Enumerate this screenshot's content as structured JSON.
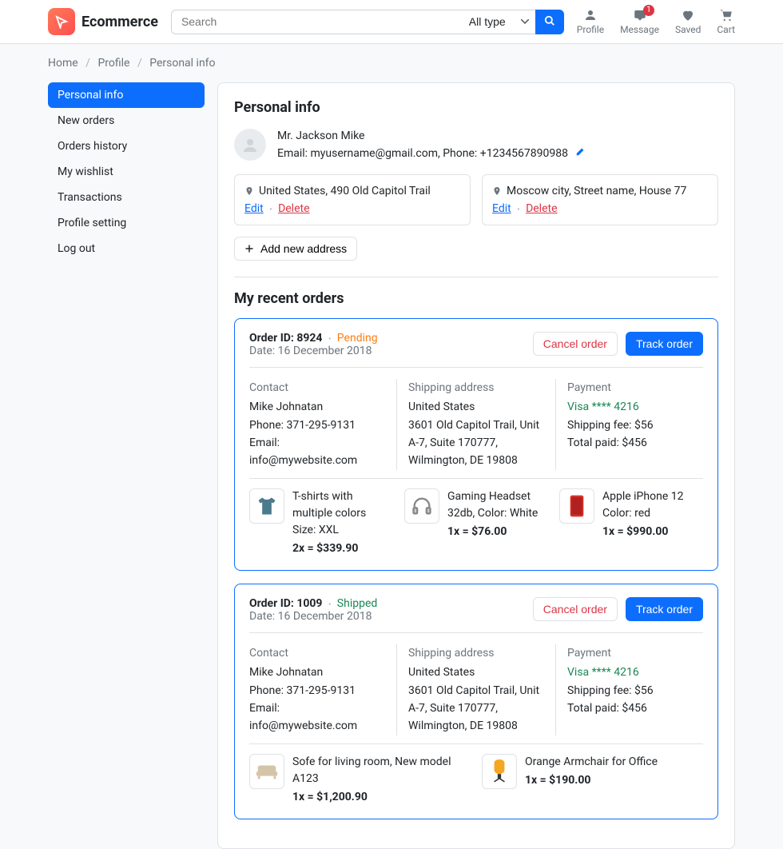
{
  "brand": "Ecommerce",
  "search": {
    "placeholder": "Search",
    "select": "All type"
  },
  "headerNav": {
    "profile": "Profile",
    "message": "Message",
    "messageBadge": "1",
    "saved": "Saved",
    "cart": "Cart"
  },
  "breadcrumb": {
    "home": "Home",
    "profile": "Profile",
    "current": "Personal info"
  },
  "sidebar": [
    "Personal info",
    "New orders",
    "Orders history",
    "My wishlist",
    "Transactions",
    "Profile setting",
    "Log out"
  ],
  "personal": {
    "heading": "Personal info",
    "name": "Mr. Jackson Mike",
    "contact": "Email: myusername@gmail.com, Phone: +1234567890988",
    "addresses": [
      {
        "line": "United States, 490 Old Capitol Trail",
        "edit": "Edit",
        "delete": "Delete"
      },
      {
        "line": "Moscow city, Street name, House 77",
        "edit": "Edit",
        "delete": "Delete"
      }
    ],
    "addBtn": "Add new address"
  },
  "recent": {
    "heading": "My recent orders",
    "orders": [
      {
        "idLabel": "Order ID: 8924",
        "status": "Pending",
        "statusClass": "status-pending",
        "date": "Date: 16 December 2018",
        "cancel": "Cancel order",
        "track": "Track order",
        "contact": {
          "heading": "Contact",
          "name": "Mike Johnatan",
          "phone": "Phone: 371-295-9131",
          "email": "Email: info@mywebsite.com"
        },
        "shipping": {
          "heading": "Shipping address",
          "country": "United States",
          "line": "3601 Old Capitol Trail, Unit A-7, Suite 170777, Wilmington, DE 19808"
        },
        "payment": {
          "heading": "Payment",
          "card": "Visa **** 4216",
          "fee": "Shipping fee: $56",
          "total": "Total paid: $456"
        },
        "items": [
          {
            "name": "T-shirts with multiple colors",
            "variant": "Size: XXL",
            "price": "2x = $339.90",
            "icon": "tshirt"
          },
          {
            "name": "Gaming Headset 32db, Color: White",
            "variant": "",
            "price": "1x = $76.00",
            "icon": "headset"
          },
          {
            "name": "Apple iPhone 12",
            "variant": "Color: red",
            "price": "1x = $990.00",
            "icon": "phone"
          }
        ]
      },
      {
        "idLabel": "Order ID: 1009",
        "status": "Shipped",
        "statusClass": "status-shipped",
        "date": "Date: 16 December 2018",
        "cancel": "Cancel order",
        "track": "Track order",
        "contact": {
          "heading": "Contact",
          "name": "Mike Johnatan",
          "phone": "Phone: 371-295-9131",
          "email": "Email: info@mywebsite.com"
        },
        "shipping": {
          "heading": "Shipping address",
          "country": "United States",
          "line": "3601 Old Capitol Trail, Unit A-7, Suite 170777, Wilmington, DE 19808"
        },
        "payment": {
          "heading": "Payment",
          "card": "Visa **** 4216",
          "fee": "Shipping fee: $56",
          "total": "Total paid: $456"
        },
        "items": [
          {
            "name": "Sofe for living room, New model A123",
            "variant": "",
            "price": "1x = $1,200.90",
            "icon": "sofa"
          },
          {
            "name": "Orange Armchair for Office",
            "variant": "",
            "price": "1x = $190.00",
            "icon": "chair"
          }
        ]
      }
    ]
  }
}
